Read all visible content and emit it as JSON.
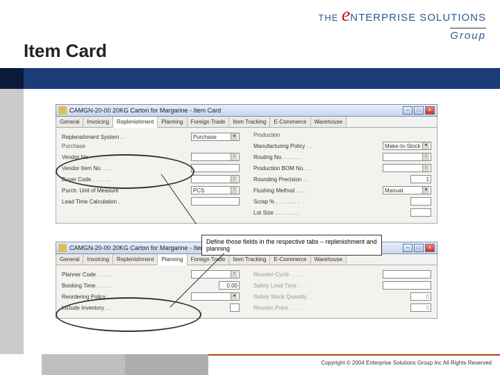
{
  "logo": {
    "the": "THE",
    "n": "NTERPRISE SOLUTIONS",
    "group": "Group"
  },
  "title": "Item Card",
  "win1": {
    "title": "CAMGN-20-00 20KG Carton for Margarine - Item Card",
    "tabs": [
      "General",
      "Invoicing",
      "Replenishment",
      "Planning",
      "Foreign Trade",
      "Item Tracking",
      "E-Commerce",
      "Warehouse"
    ],
    "activeIdx": "2",
    "left": {
      "topLabel": "Replenishment System . .",
      "topValue": "Purchase",
      "section": "Purchase",
      "r1l": "Vendor No. . . . . . .",
      "r1v": "",
      "r2l": "Vendor Item No. . . .",
      "r2v": "",
      "r3l": "Buyer Code . . . . . .",
      "r3v": "",
      "r4l": "Purch. Unit of Measure",
      "r4v": "PCS",
      "r5l": "Lead Time Calculation .",
      "r5v": ""
    },
    "right": {
      "section": "Production",
      "r1l": "Manufacturing Policy . .",
      "r1v": "Make-to-Stock",
      "r2l": "Routing No. . . . . . .",
      "r2v": "",
      "r3l": "Production BOM No. . .",
      "r3v": "",
      "r4l": "Rounding Precision . .",
      "r4v": "1",
      "r5l": "Flushing Method . . . .",
      "r5v": "Manual",
      "r6l": "Scrap % . . . . . . . .",
      "r6v": "",
      "r7l": "Lot Size . . . . . . . .",
      "r7v": ""
    }
  },
  "callout": "Define those fields in the respective tabs – replenishment and planning",
  "win2": {
    "title": "CAMGN-20-00 20KG Carton for Margarine - Item Card",
    "tabs": [
      "General",
      "Invoicing",
      "Replenishment",
      "Planning",
      "Foreign Trade",
      "Item Tracking",
      "E-Commerce",
      "Warehouse"
    ],
    "activeIdx": "3",
    "left": {
      "r1l": "Planner Code . . . . .",
      "r1v": "",
      "r2l": "Booking Time . . . . .",
      "r2v": "0.00",
      "r3l": "Reordering Policy . . .",
      "r3v": "",
      "r4l": "Include Inventory . .",
      "r4v": ""
    },
    "right": {
      "r1l": "Reorder Cycle . . . . .",
      "r1v": "",
      "r2l": "Safety Lead Time . . .",
      "r2v": "",
      "r3l": "Safety Stock Quantity . .",
      "r3v": "0",
      "r4l": "Reorder Point . . . . .",
      "r4v": "0"
    }
  },
  "footer": "Copyright © 2004 Enterprise Solutions Group Inc All Rights Reserved"
}
